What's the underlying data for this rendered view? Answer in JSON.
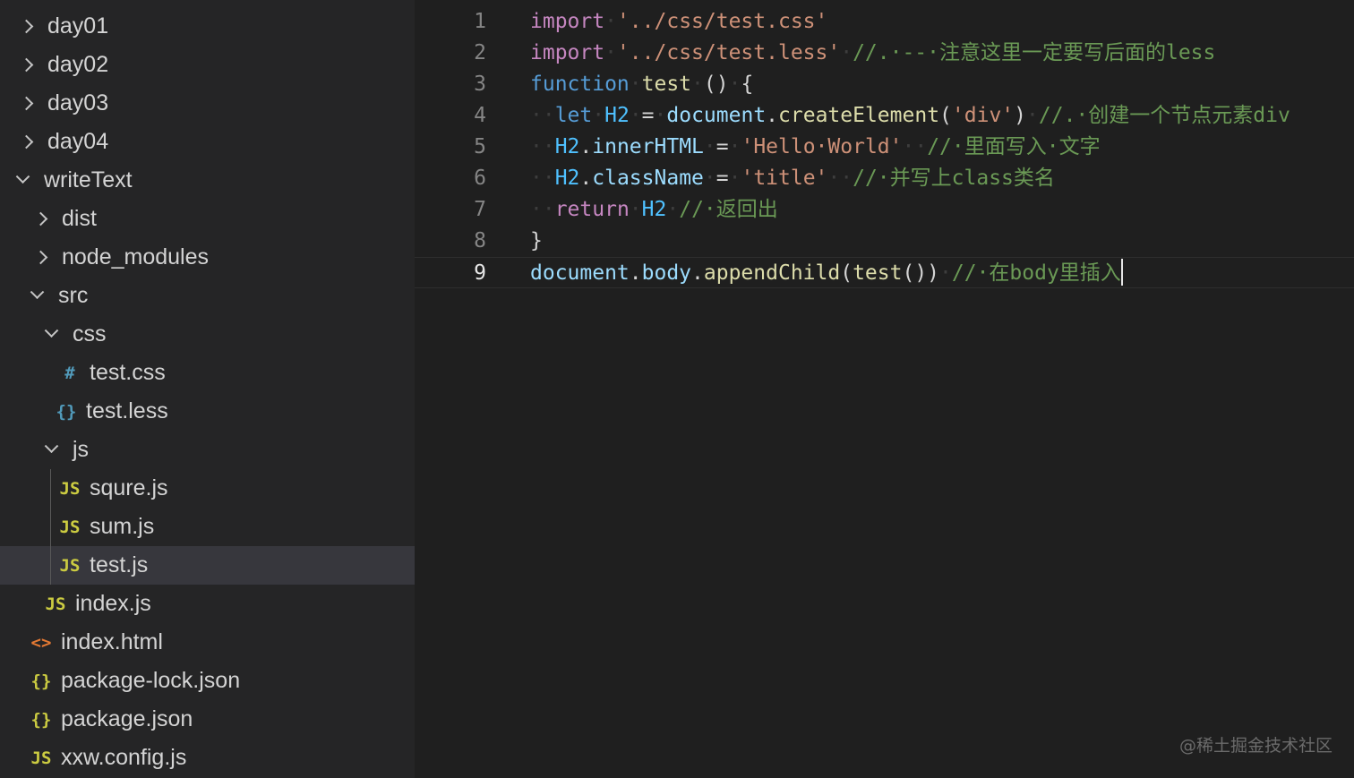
{
  "explorer": {
    "items": [
      {
        "label": "day01",
        "kind": "folder",
        "expanded": false
      },
      {
        "label": "day02",
        "kind": "folder",
        "expanded": false
      },
      {
        "label": "day03",
        "kind": "folder",
        "expanded": false
      },
      {
        "label": "day04",
        "kind": "folder",
        "expanded": false
      },
      {
        "label": "writeText",
        "kind": "folder",
        "expanded": true
      },
      {
        "label": "dist",
        "kind": "folder",
        "expanded": false
      },
      {
        "label": "node_modules",
        "kind": "folder",
        "expanded": false
      },
      {
        "label": "src",
        "kind": "folder",
        "expanded": true
      },
      {
        "label": "css",
        "kind": "folder",
        "expanded": true
      },
      {
        "label": "test.css",
        "kind": "file",
        "icon": "#",
        "icon_name": "css-file-icon",
        "icon_color": "#519aba"
      },
      {
        "label": "test.less",
        "kind": "file",
        "icon": "{}",
        "icon_name": "less-file-icon",
        "icon_color": "#519aba"
      },
      {
        "label": "js",
        "kind": "folder",
        "expanded": true
      },
      {
        "label": "squre.js",
        "kind": "file",
        "icon": "JS",
        "icon_name": "js-file-icon",
        "icon_color": "#cbcb41"
      },
      {
        "label": "sum.js",
        "kind": "file",
        "icon": "JS",
        "icon_name": "js-file-icon",
        "icon_color": "#cbcb41"
      },
      {
        "label": "test.js",
        "kind": "file",
        "icon": "JS",
        "icon_name": "js-file-icon",
        "icon_color": "#cbcb41",
        "selected": true
      },
      {
        "label": "index.js",
        "kind": "file",
        "icon": "JS",
        "icon_name": "js-file-icon",
        "icon_color": "#cbcb41"
      },
      {
        "label": "index.html",
        "kind": "file",
        "icon": "<>",
        "icon_name": "html-file-icon",
        "icon_color": "#e37933"
      },
      {
        "label": "package-lock.json",
        "kind": "file",
        "icon": "{}",
        "icon_name": "json-file-icon",
        "icon_color": "#cbcb41"
      },
      {
        "label": "package.json",
        "kind": "file",
        "icon": "{}",
        "icon_name": "json-file-icon",
        "icon_color": "#cbcb41"
      },
      {
        "label": "xxw.config.js",
        "kind": "file",
        "icon": "JS",
        "icon_name": "js-file-icon",
        "icon_color": "#cbcb41"
      }
    ]
  },
  "editor": {
    "current_line": 9,
    "lines": [
      {
        "number": "1",
        "tokens": [
          {
            "t": "import",
            "c": "kw"
          },
          {
            "t": "·",
            "c": "ws"
          },
          {
            "t": "'../css/test.css'",
            "c": "str"
          }
        ]
      },
      {
        "number": "2",
        "tokens": [
          {
            "t": "import",
            "c": "kw"
          },
          {
            "t": "·",
            "c": "ws"
          },
          {
            "t": "'../css/test.less'",
            "c": "str"
          },
          {
            "t": "·",
            "c": "ws"
          },
          {
            "t": "//.·--·注意这里一定要写后面的less",
            "c": "cm"
          }
        ]
      },
      {
        "number": "3",
        "tokens": [
          {
            "t": "function",
            "c": "kwb"
          },
          {
            "t": "·",
            "c": "ws"
          },
          {
            "t": "test",
            "c": "fn"
          },
          {
            "t": "·",
            "c": "ws"
          },
          {
            "t": "()",
            "c": "p"
          },
          {
            "t": "·",
            "c": "ws"
          },
          {
            "t": "{",
            "c": "p"
          }
        ]
      },
      {
        "number": "4",
        "tokens": [
          {
            "t": "··",
            "c": "ws"
          },
          {
            "t": "let",
            "c": "kwb"
          },
          {
            "t": "·",
            "c": "ws"
          },
          {
            "t": "H2",
            "c": "cnst"
          },
          {
            "t": "·",
            "c": "ws"
          },
          {
            "t": "=",
            "c": "p"
          },
          {
            "t": "·",
            "c": "ws"
          },
          {
            "t": "document",
            "c": "var"
          },
          {
            "t": ".",
            "c": "p"
          },
          {
            "t": "createElement",
            "c": "fn"
          },
          {
            "t": "(",
            "c": "p"
          },
          {
            "t": "'div'",
            "c": "str"
          },
          {
            "t": ")",
            "c": "p"
          },
          {
            "t": "·",
            "c": "ws"
          },
          {
            "t": "//.·创建一个节点元素div",
            "c": "cm"
          }
        ]
      },
      {
        "number": "5",
        "tokens": [
          {
            "t": "··",
            "c": "ws"
          },
          {
            "t": "H2",
            "c": "cnst"
          },
          {
            "t": ".",
            "c": "p"
          },
          {
            "t": "innerHTML",
            "c": "var"
          },
          {
            "t": "·",
            "c": "ws"
          },
          {
            "t": "=",
            "c": "p"
          },
          {
            "t": "·",
            "c": "ws"
          },
          {
            "t": "'Hello·World'",
            "c": "str"
          },
          {
            "t": "··",
            "c": "ws"
          },
          {
            "t": "//·里面写入·文字",
            "c": "cm"
          }
        ]
      },
      {
        "number": "6",
        "tokens": [
          {
            "t": "··",
            "c": "ws"
          },
          {
            "t": "H2",
            "c": "cnst"
          },
          {
            "t": ".",
            "c": "p"
          },
          {
            "t": "className",
            "c": "var"
          },
          {
            "t": "·",
            "c": "ws"
          },
          {
            "t": "=",
            "c": "p"
          },
          {
            "t": "·",
            "c": "ws"
          },
          {
            "t": "'title'",
            "c": "str"
          },
          {
            "t": "··",
            "c": "ws"
          },
          {
            "t": "//·并写上class类名",
            "c": "cm"
          }
        ]
      },
      {
        "number": "7",
        "tokens": [
          {
            "t": "··",
            "c": "ws"
          },
          {
            "t": "return",
            "c": "kw"
          },
          {
            "t": "·",
            "c": "ws"
          },
          {
            "t": "H2",
            "c": "cnst"
          },
          {
            "t": "·",
            "c": "ws"
          },
          {
            "t": "//·返回出",
            "c": "cm"
          }
        ]
      },
      {
        "number": "8",
        "tokens": [
          {
            "t": "}",
            "c": "p"
          }
        ]
      },
      {
        "number": "9",
        "tokens": [
          {
            "t": "document",
            "c": "var"
          },
          {
            "t": ".",
            "c": "p"
          },
          {
            "t": "body",
            "c": "var"
          },
          {
            "t": ".",
            "c": "p"
          },
          {
            "t": "appendChild",
            "c": "fn"
          },
          {
            "t": "(",
            "c": "p"
          },
          {
            "t": "test",
            "c": "fn"
          },
          {
            "t": "())",
            "c": "p"
          },
          {
            "t": "·",
            "c": "ws"
          },
          {
            "t": "//·在body里插入",
            "c": "cm"
          }
        ]
      }
    ]
  },
  "watermark": "@稀土掘金技术社区"
}
